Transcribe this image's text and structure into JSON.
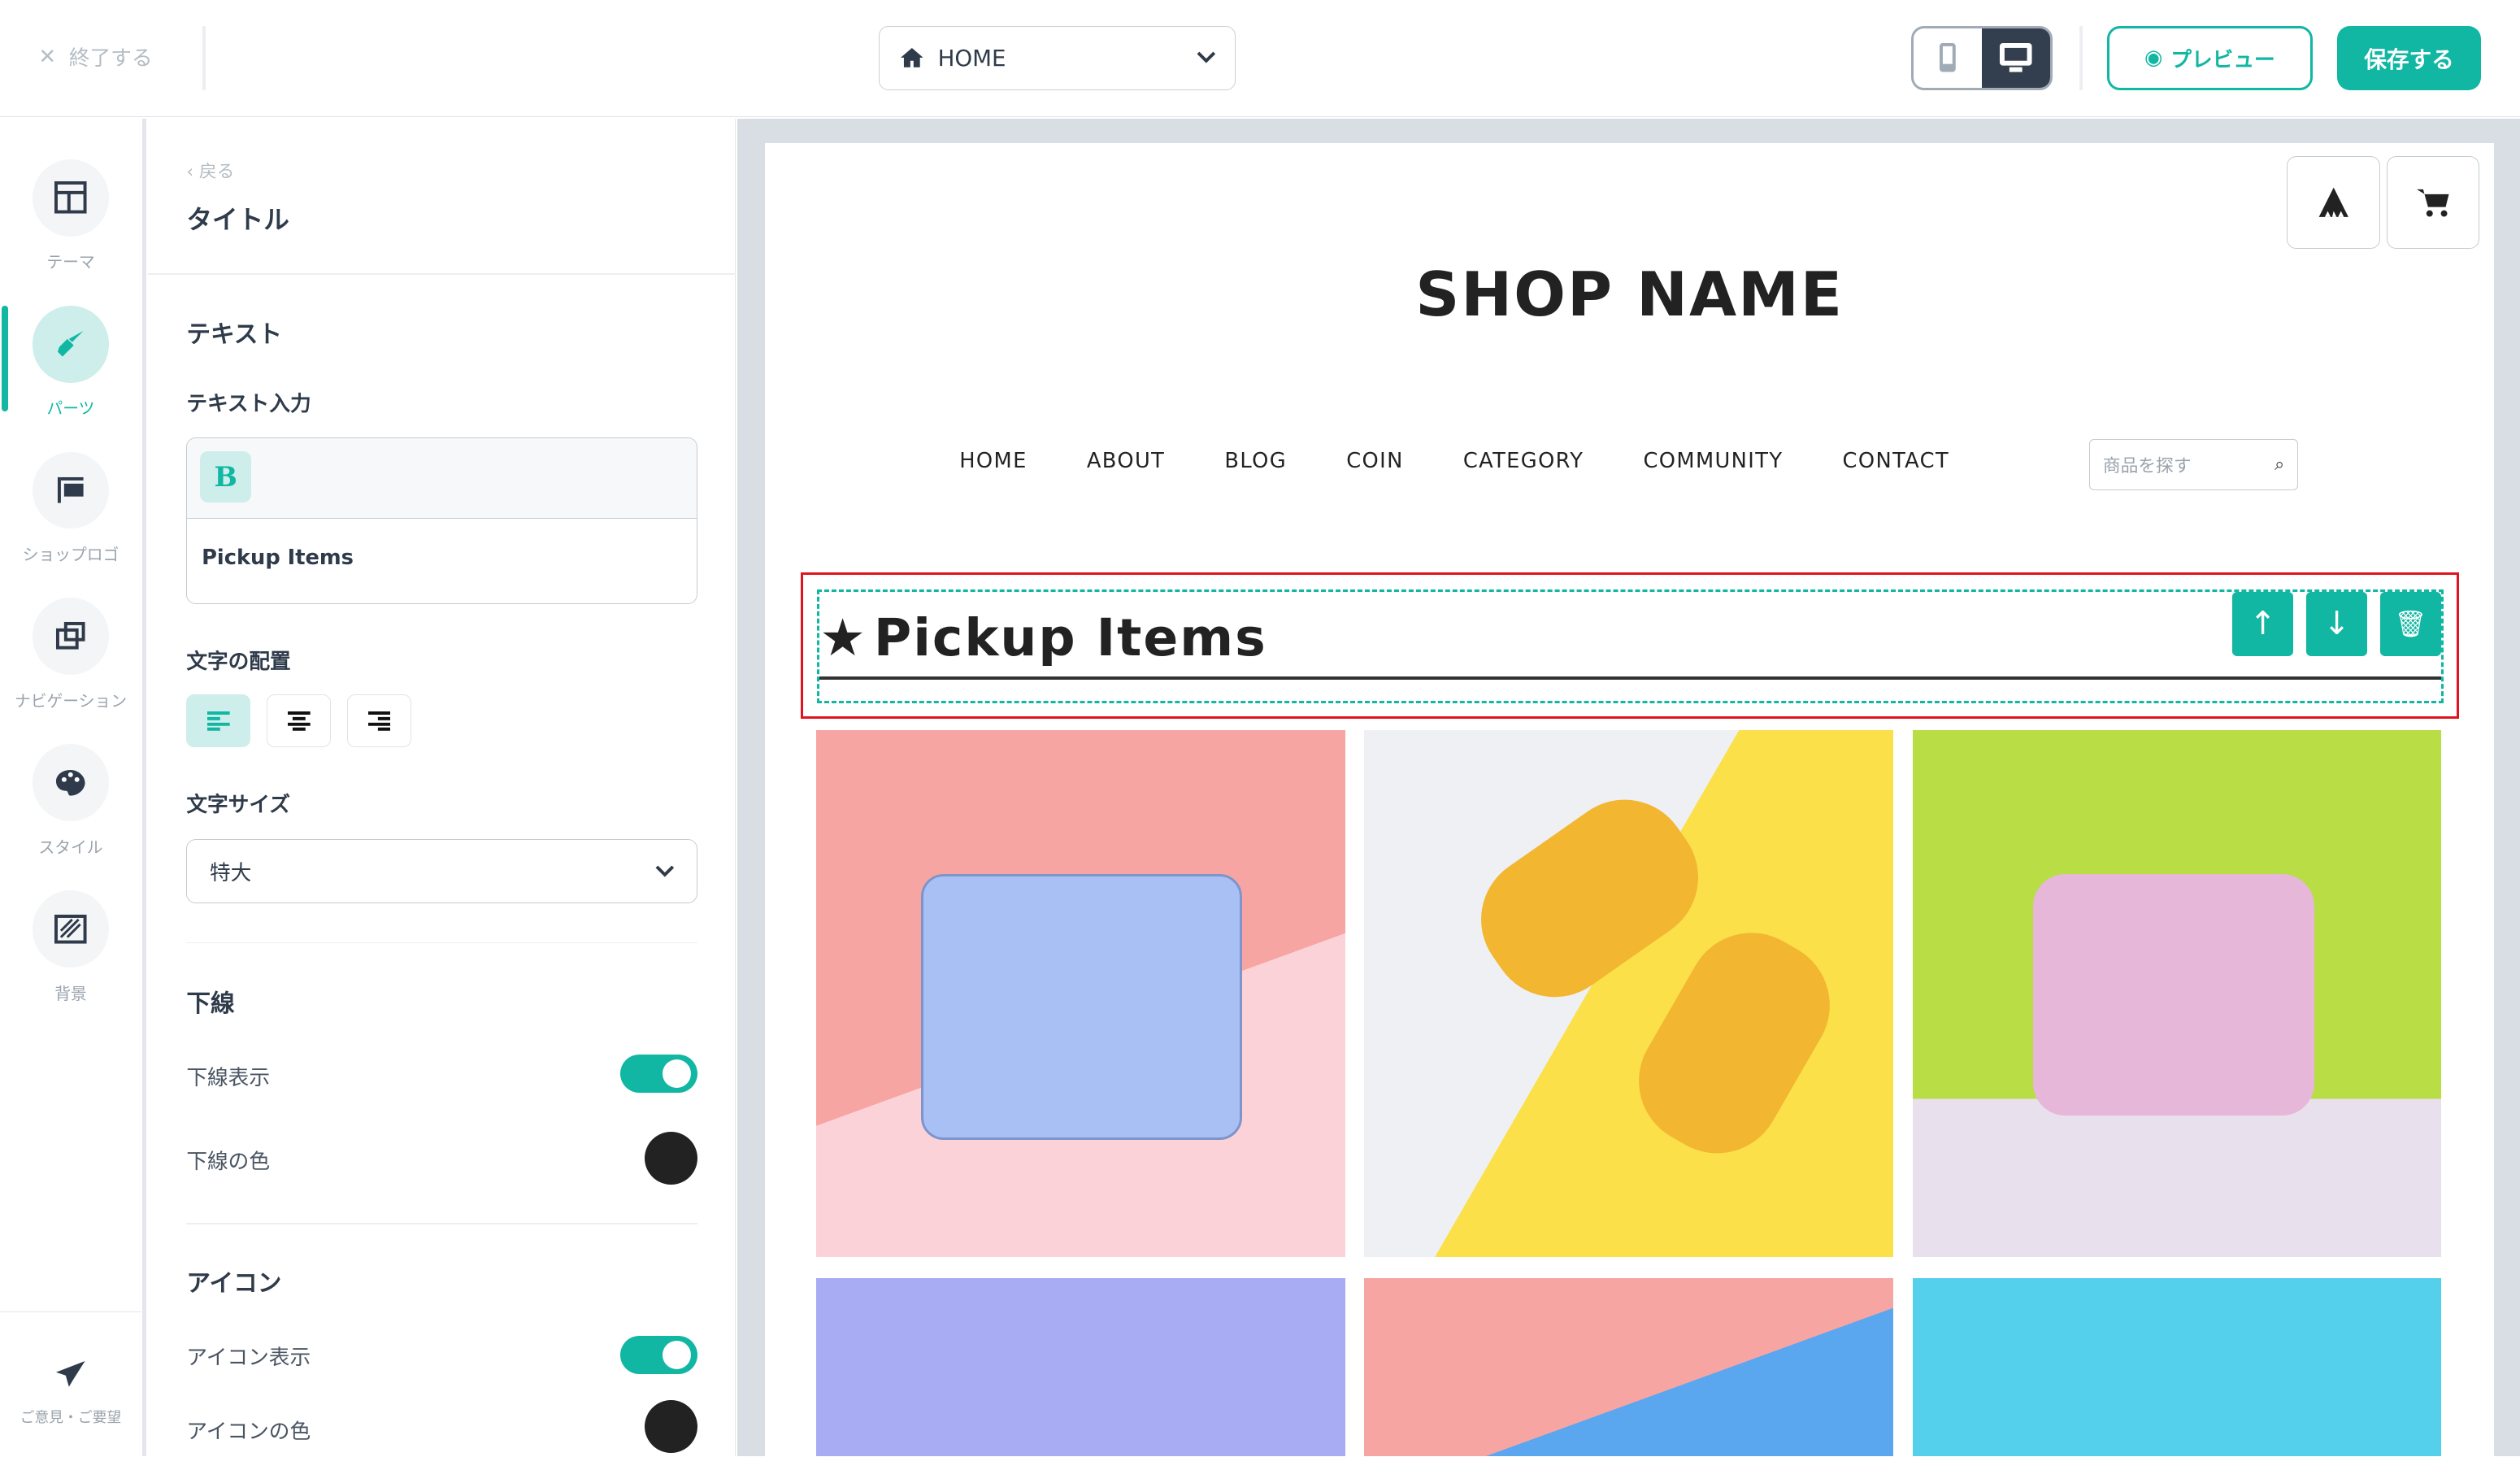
{
  "topbar": {
    "exit_label": "終了する",
    "page_select": "HOME",
    "preview_label": "プレビュー",
    "save_label": "保存する",
    "device_mode": "desktop"
  },
  "rail": {
    "items": [
      {
        "label": "テーマ",
        "icon": "layout-icon"
      },
      {
        "label": "パーツ",
        "icon": "brush-icon",
        "active": true
      },
      {
        "label": "ショップロゴ",
        "icon": "signboard-icon"
      },
      {
        "label": "ナビゲーション",
        "icon": "navigation-icon"
      },
      {
        "label": "スタイル",
        "icon": "palette-icon"
      },
      {
        "label": "背景",
        "icon": "background-icon"
      }
    ],
    "feedback_label": "ご意見・ご要望"
  },
  "panel": {
    "back_label": "戻る",
    "title": "タイトル",
    "text_section": "テキスト",
    "text_input_label": "テキスト入力",
    "bold_button": "B",
    "text_value": "Pickup Items",
    "align_label": "文字の配置",
    "align_selected": "left",
    "size_label": "文字サイズ",
    "size_value": "特大",
    "underline_section": "下線",
    "underline_show_label": "下線表示",
    "underline_show": true,
    "underline_color_label": "下線の色",
    "underline_color": "#222222",
    "icon_section": "アイコン",
    "icon_show_label": "アイコン表示",
    "icon_show": true,
    "icon_color_label": "アイコンの色",
    "icon_color": "#222222"
  },
  "preview": {
    "shop_name": "SHOP NAME",
    "nav": [
      "HOME",
      "ABOUT",
      "BLOG",
      "COIN",
      "CATEGORY",
      "COMMUNITY",
      "CONTACT"
    ],
    "search_placeholder": "商品を探す",
    "section_title": "Pickup Items",
    "accent": "#11b7a2",
    "selection_color": "#e0141e"
  }
}
